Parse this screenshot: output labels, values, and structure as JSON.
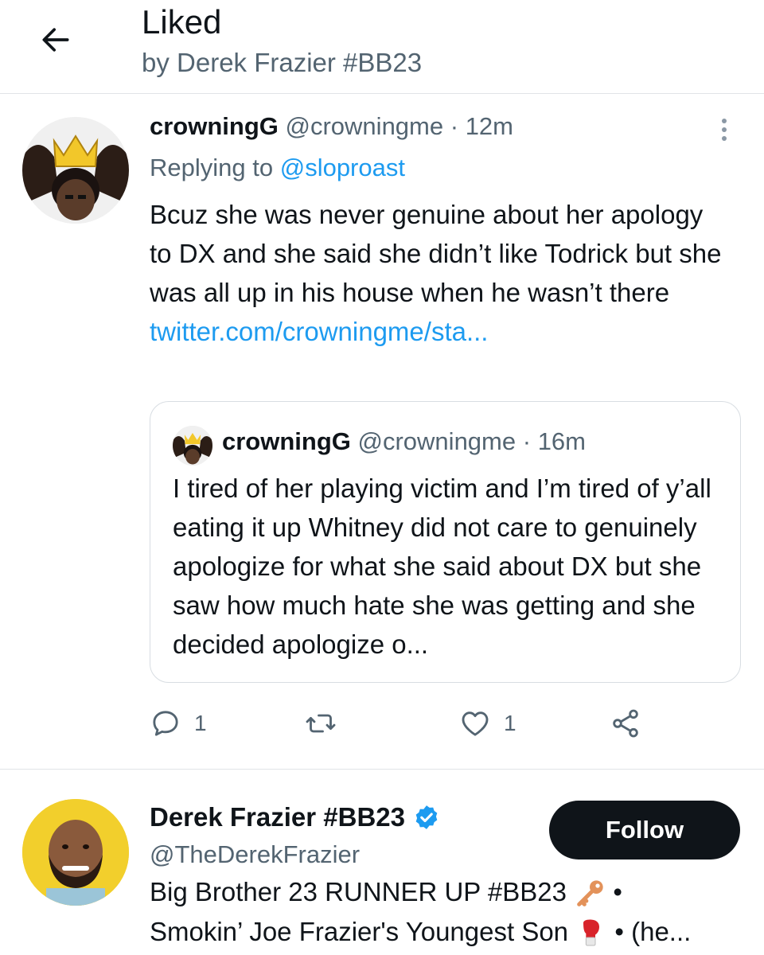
{
  "header": {
    "title": "Liked",
    "subtitle": "by Derek Frazier #BB23"
  },
  "tweet": {
    "author_name": "crowningG",
    "author_handle": "@crowningme",
    "separator": "·",
    "time": "12m",
    "replying_prefix": "Replying to",
    "replying_to": "@sloproast",
    "body": "Bcuz she was never genuine about her apology to DX and she said she didn’t like Todrick but she was all up in his house when he wasn’t there",
    "link": "twitter.com/crowningme/sta...",
    "quote": {
      "author_name": "crowningG",
      "author_handle": "@crowningme",
      "separator": "·",
      "time": "16m",
      "body": "I tired of her playing victim and I’m tired of y’all eating it up Whitney did not care to genuinely apologize for what she said about DX but she saw how much hate she was getting and she decided apologize o..."
    },
    "actions": {
      "reply_count": "1",
      "retweet_count": "",
      "like_count": "1"
    }
  },
  "profile": {
    "name": "Derek Frazier #BB23",
    "handle": "@TheDerekFrazier",
    "follow_label": "Follow",
    "bio_line1": "Big Brother 23 RUNNER UP #BB23",
    "bio_line1_end": "•",
    "bio_line2": "Smokin’ Joe Frazier's Youngest Son",
    "bio_line2_end": "• (he..."
  },
  "colors": {
    "accent": "#1d9bf0",
    "text": "#0f1419",
    "secondary": "#536471",
    "border": "#e1e4e7",
    "follow_bg": "#0f1419"
  },
  "icons": {
    "back": "arrow-left-icon",
    "more": "more-vertical-icon",
    "reply": "comment-icon",
    "retweet": "retweet-icon",
    "like": "heart-icon",
    "share": "share-icon",
    "verified": "verified-badge-icon",
    "key_emoji": "key-icon",
    "boxing_emoji": "boxing-glove-icon"
  }
}
